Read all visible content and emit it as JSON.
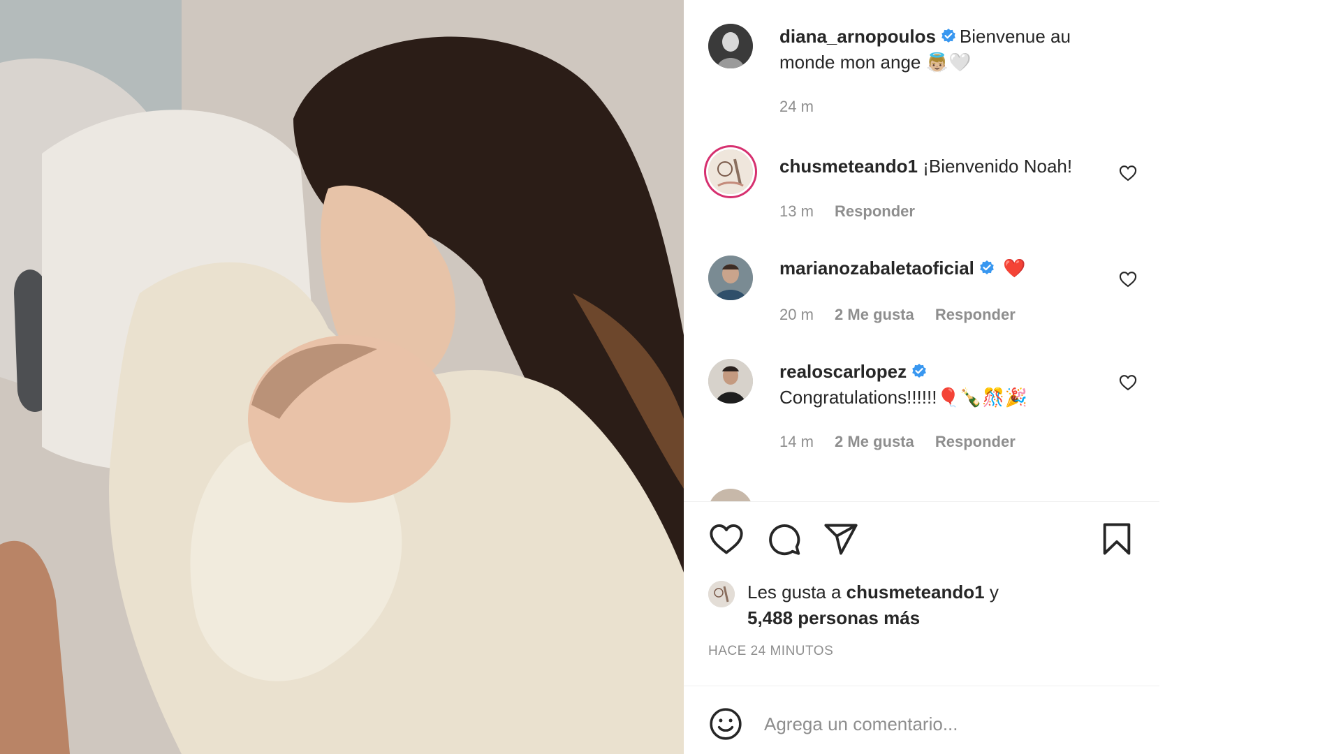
{
  "post": {
    "author": "diana_arnopoulos",
    "caption": "Bienvenue au monde mon ange 👼🏼🤍",
    "time": "24 m"
  },
  "comments": [
    {
      "user": "chusmeteando1",
      "verified": false,
      "text": "¡Bienvenido Noah!",
      "time": "13 m",
      "likes": "",
      "reply": "Responder"
    },
    {
      "user": "marianozabaletaoficial",
      "verified": true,
      "text": "❤️",
      "time": "20 m",
      "likes": "2 Me gusta",
      "reply": "Responder"
    },
    {
      "user": "realoscarlopez",
      "verified": true,
      "text": "Congratulations!!!!!!🎈🍾🎊🎉",
      "time": "14 m",
      "likes": "2 Me gusta",
      "reply": "Responder"
    }
  ],
  "likes": {
    "prefix": "Les gusta a",
    "user": "chusmeteando1",
    "join": "y",
    "count": "5,488 personas más"
  },
  "timestamp": "HACE 24 MINUTOS",
  "add_comment": {
    "placeholder": "Agrega un comentario..."
  },
  "icons": {
    "like": "heart-icon",
    "comment": "comment-icon",
    "share": "send-icon",
    "save": "bookmark-icon",
    "emoji": "smiley-icon",
    "verified": "verified-badge-icon"
  },
  "colors": {
    "verified": "#3897f0",
    "story_ring": "#d6306f",
    "muted": "#8e8e8e",
    "text": "#262626"
  }
}
